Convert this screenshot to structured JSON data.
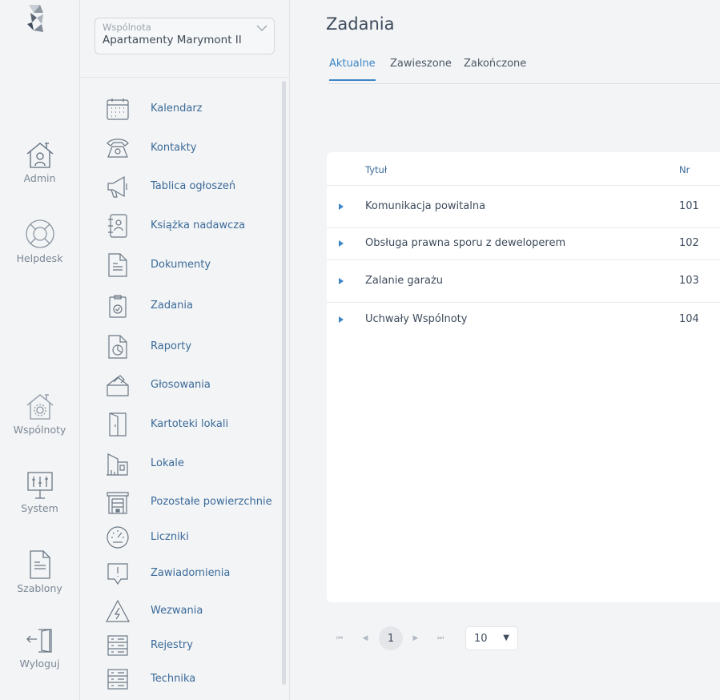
{
  "rail": {
    "items": [
      {
        "label": "Admin",
        "icon": "house-person-icon"
      },
      {
        "label": "Helpdesk",
        "icon": "lifebuoy-icon"
      },
      {
        "label": "Wspólnoty",
        "icon": "house-gear-icon"
      },
      {
        "label": "System",
        "icon": "monitor-sliders-icon"
      },
      {
        "label": "Szablony",
        "icon": "document-icon"
      },
      {
        "label": "Wyloguj",
        "icon": "logout-door-icon"
      }
    ]
  },
  "community_select": {
    "label": "Wspólnota",
    "value": "Apartamenty Marymont II"
  },
  "nav": {
    "items": [
      {
        "label": "Kalendarz",
        "icon": "calendar-icon"
      },
      {
        "label": "Kontakty",
        "icon": "telephone-icon"
      },
      {
        "label": "Tablica ogłoszeń",
        "icon": "megaphone-icon"
      },
      {
        "label": "Książka nadawcza",
        "icon": "address-book-icon"
      },
      {
        "label": "Dokumenty",
        "icon": "document-icon"
      },
      {
        "label": "Zadania",
        "icon": "clipboard-check-icon"
      },
      {
        "label": "Raporty",
        "icon": "report-chart-icon"
      },
      {
        "label": "Głosowania",
        "icon": "ballot-box-icon"
      },
      {
        "label": "Kartoteki lokali",
        "icon": "door-icon"
      },
      {
        "label": "Lokale",
        "icon": "buildings-icon"
      },
      {
        "label": "Pozostałe powierzchnie",
        "icon": "garage-icon"
      },
      {
        "label": "Liczniki",
        "icon": "gauge-icon"
      },
      {
        "label": "Zawiadomienia",
        "icon": "notification-bubble-icon"
      },
      {
        "label": "Wezwania",
        "icon": "warning-triangle-icon"
      },
      {
        "label": "Rejestry",
        "icon": "server-rack-icon"
      },
      {
        "label": "Technika",
        "icon": "server-rack-icon"
      }
    ]
  },
  "page": {
    "title": "Zadania",
    "tabs": [
      {
        "label": "Aktualne",
        "active": true
      },
      {
        "label": "Zawieszone",
        "active": false
      },
      {
        "label": "Zakończone",
        "active": false
      }
    ]
  },
  "table": {
    "columns": [
      "Tytuł",
      "Nr"
    ],
    "rows": [
      {
        "title": "Komunikacja powitalna",
        "nr": "101"
      },
      {
        "title": "Obsługa prawna sporu z deweloperem",
        "nr": "102"
      },
      {
        "title": "Zalanie garażu",
        "nr": "103"
      },
      {
        "title": "Uchwały Wspólnoty",
        "nr": "104"
      }
    ]
  },
  "pagination": {
    "current_page": "1",
    "page_size": "10",
    "page_size_caret": "▼"
  },
  "colors": {
    "accent": "#3d86c6",
    "link": "#3a6a9a",
    "background": "#f3f4f5",
    "card": "#ffffff"
  }
}
